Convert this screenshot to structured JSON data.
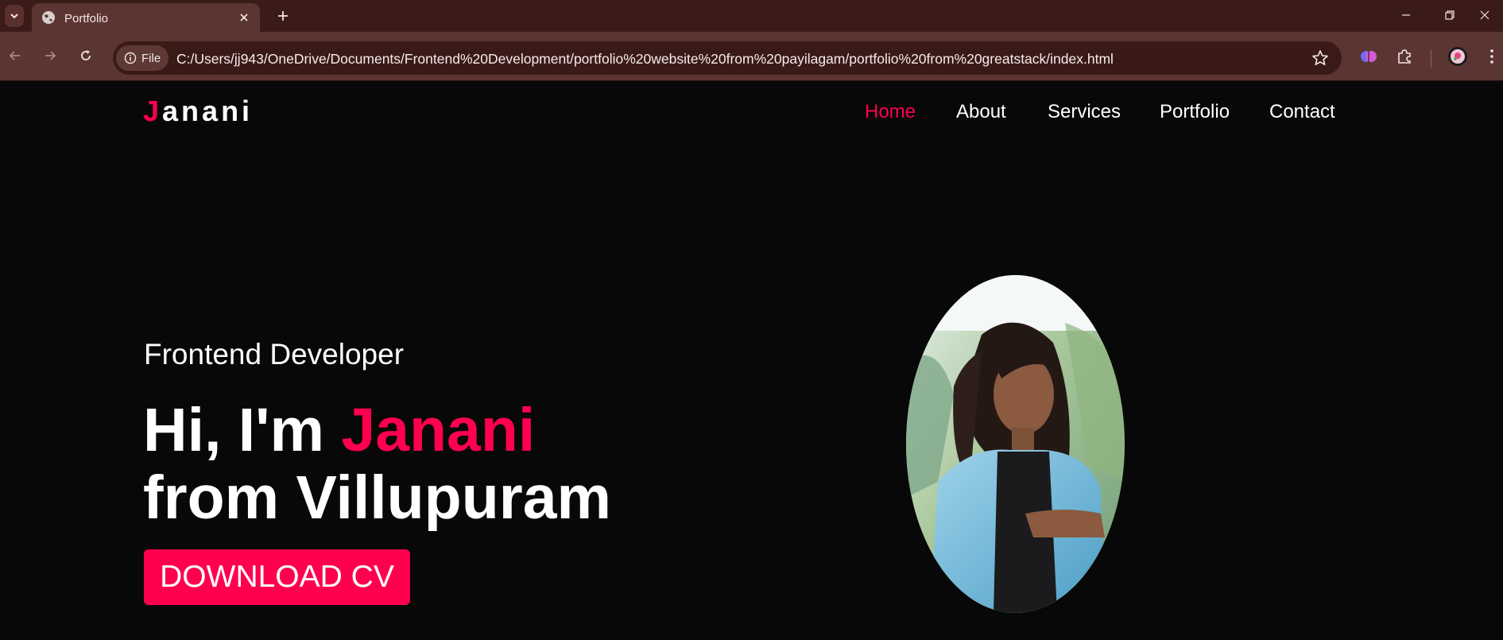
{
  "browser": {
    "tab": {
      "title": "Portfolio",
      "favicon": "globe-icon"
    },
    "omnibox": {
      "scheme_label": "File",
      "url": "C:/Users/jj943/OneDrive/Documents/Frontend%20Development/portfolio%20website%20from%20payilagam/portfolio%20from%20greatstack/index.html"
    }
  },
  "header": {
    "logo": {
      "first_letter": "J",
      "rest": "anani"
    },
    "nav": [
      {
        "label": "Home",
        "active": true
      },
      {
        "label": "About",
        "active": false
      },
      {
        "label": "Services",
        "active": false
      },
      {
        "label": "Portfolio",
        "active": false
      },
      {
        "label": "Contact",
        "active": false
      }
    ]
  },
  "hero": {
    "role": "Frontend Developer",
    "greeting": "Hi, I'm",
    "name": "Janani",
    "line2": "from Villupuram",
    "cta_label": "DOWNLOAD CV"
  },
  "colors": {
    "accent": "#ff004f",
    "page_bg": "#080808",
    "chrome_dark": "#3b1b18",
    "chrome_light": "#5b3531"
  }
}
